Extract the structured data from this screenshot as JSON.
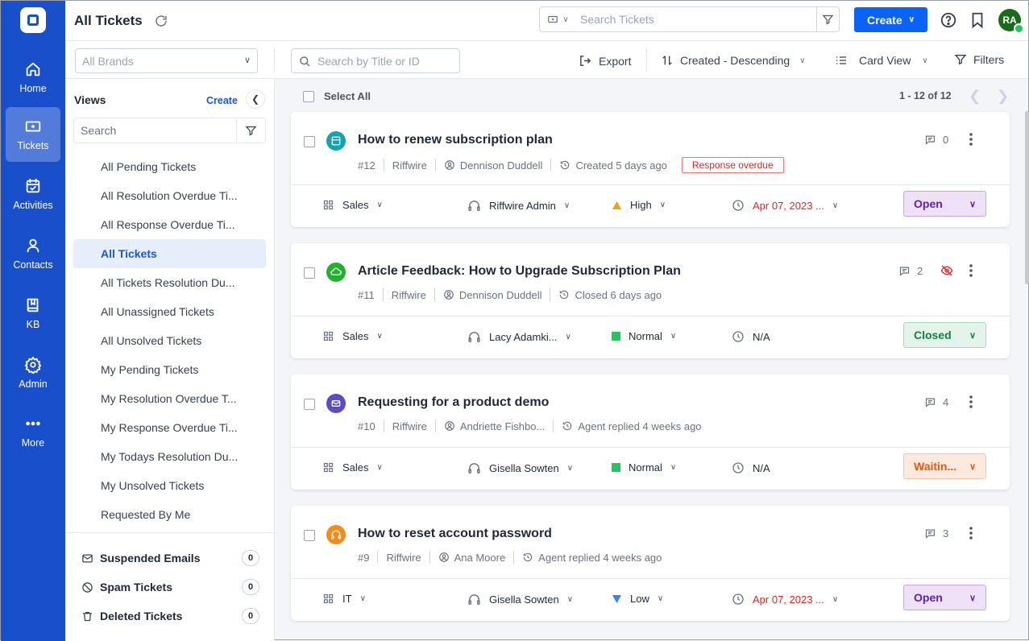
{
  "rail": {
    "items": [
      {
        "label": "Home",
        "icon": "home-icon"
      },
      {
        "label": "Tickets",
        "icon": "ticket-icon",
        "active": true
      },
      {
        "label": "Activities",
        "icon": "calendar-check-icon"
      },
      {
        "label": "Contacts",
        "icon": "user-icon"
      },
      {
        "label": "KB",
        "icon": "book-icon"
      },
      {
        "label": "Admin",
        "icon": "gear-icon"
      },
      {
        "label": "More",
        "icon": "more-dots-icon"
      }
    ]
  },
  "header": {
    "title": "All Tickets",
    "search_placeholder": "Search Tickets",
    "create_label": "Create",
    "avatar_initials": "RA"
  },
  "toolbar": {
    "brands_placeholder": "All Brands",
    "search_placeholder": "Search by Title or ID",
    "export_label": "Export",
    "sort_label": "Created - Descending",
    "view_label": "Card View",
    "filters_label": "Filters"
  },
  "views": {
    "heading": "Views",
    "create_label": "Create",
    "search_placeholder": "Search",
    "items": [
      "All Pending Tickets",
      "All Resolution Overdue Ti...",
      "All Response Overdue Ti...",
      "All Tickets",
      "All Tickets Resolution Du...",
      "All Unassigned Tickets",
      "All Unsolved Tickets",
      "My Pending Tickets",
      "My Resolution Overdue T...",
      "My Response Overdue Ti...",
      "My Todays Resolution Du...",
      "My Unsolved Tickets",
      "Requested By Me"
    ],
    "active_index": 3,
    "special": [
      {
        "label": "Suspended Emails",
        "count": "0",
        "icon": "mail-icon"
      },
      {
        "label": "Spam Tickets",
        "count": "0",
        "icon": "ban-icon"
      },
      {
        "label": "Deleted Tickets",
        "count": "0",
        "icon": "trash-icon"
      }
    ]
  },
  "list": {
    "select_all_label": "Select All",
    "pagination": "1 - 12 of 12"
  },
  "tickets": [
    {
      "title": "How to renew subscription plan",
      "id": "#12",
      "brand": "Riffwire",
      "requester": "Dennison Duddell",
      "activity": "Created 5 days ago",
      "badge": "Response overdue",
      "comments": "0",
      "hidden": false,
      "channel_icon": "web-form-icon",
      "channel_color": "#14a3b0",
      "group": "Sales",
      "agent": "Riffwire Admin",
      "priority": "High",
      "priority_color": "#f59e0b",
      "priority_shape": "triangle-up",
      "due": "Apr 07, 2023 ...",
      "due_overdue": true,
      "status": "Open",
      "status_bg": "#efe2f8",
      "status_border": "#c9a4ea",
      "status_color": "#5b21b6"
    },
    {
      "title": "Article Feedback: How to Upgrade Subscription Plan",
      "id": "#11",
      "brand": "Riffwire",
      "requester": "Dennison Duddell",
      "activity": "Closed 6 days ago",
      "badge": "",
      "comments": "2",
      "hidden": true,
      "channel_icon": "feedback-cloud-icon",
      "channel_color": "#22b02e",
      "group": "Sales",
      "agent": "Lacy Adamki...",
      "priority": "Normal",
      "priority_color": "#22c55e",
      "priority_shape": "square",
      "due": "N/A",
      "due_overdue": false,
      "status": "Closed",
      "status_bg": "#e3f4ea",
      "status_border": "#a7d7b9",
      "status_color": "#15803d"
    },
    {
      "title": "Requesting for a product demo",
      "id": "#10",
      "brand": "Riffwire",
      "requester": "Andriette Fishbo...",
      "activity": "Agent replied 4 weeks ago",
      "badge": "",
      "comments": "4",
      "hidden": false,
      "channel_icon": "email-icon",
      "channel_color": "#5b4bc4",
      "group": "Sales",
      "agent": "Gisella Sowten",
      "priority": "Normal",
      "priority_color": "#22c55e",
      "priority_shape": "square",
      "due": "N/A",
      "due_overdue": false,
      "status": "Waitin...",
      "status_bg": "#fde9de",
      "status_border": "#f6c3a6",
      "status_color": "#ea580c"
    },
    {
      "title": "How to reset account password",
      "id": "#9",
      "brand": "Riffwire",
      "requester": "Ana Moore",
      "activity": "Agent replied 4 weeks ago",
      "badge": "",
      "comments": "3",
      "hidden": false,
      "channel_icon": "headset-icon",
      "channel_color": "#f28c1b",
      "group": "IT",
      "agent": "Gisella Sowten",
      "priority": "Low",
      "priority_color": "#3b82f6",
      "priority_shape": "triangle-down",
      "due": "Apr 07, 2023 ...",
      "due_overdue": true,
      "status": "Open",
      "status_bg": "#efe2f8",
      "status_border": "#c9a4ea",
      "status_color": "#5b21b6"
    }
  ]
}
